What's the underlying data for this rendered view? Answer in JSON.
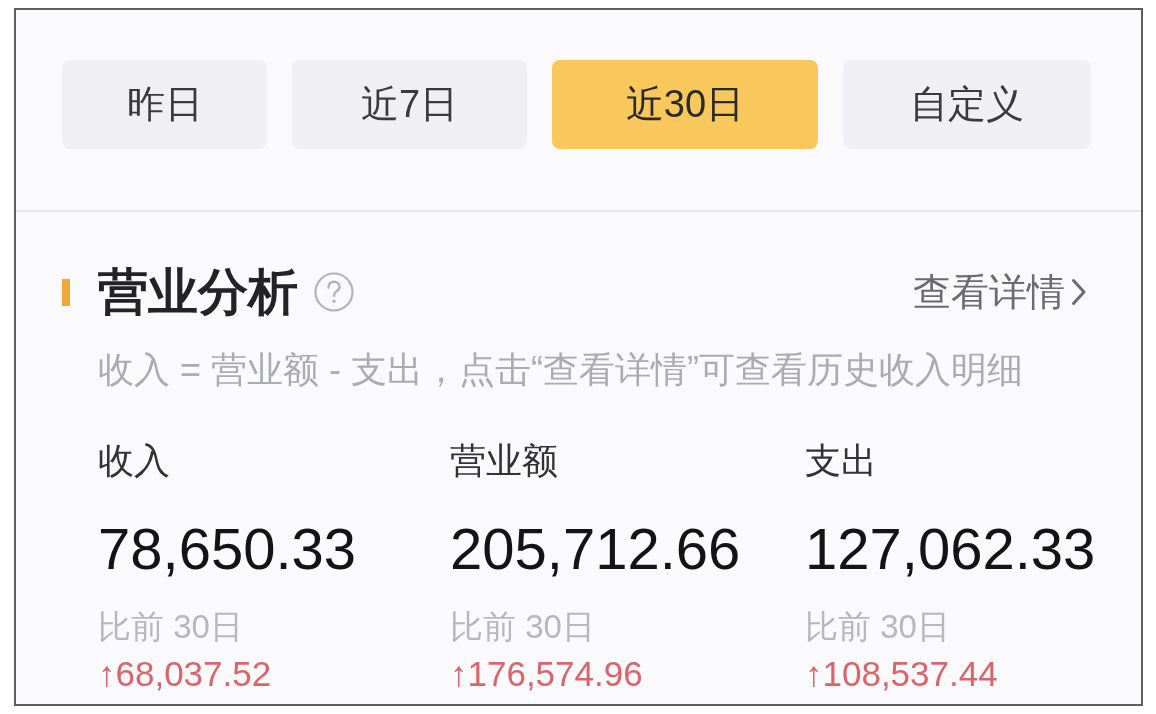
{
  "tabs": [
    {
      "label": "昨日",
      "selected": false
    },
    {
      "label": "近7日",
      "selected": false
    },
    {
      "label": "近30日",
      "selected": true
    },
    {
      "label": "自定义",
      "selected": false
    }
  ],
  "section": {
    "title": "营业分析",
    "details_link": "查看详情",
    "description": "收入 = 营业额 - 支出，点击“查看详情”可查看历史收入明细"
  },
  "metrics": [
    {
      "label": "收入",
      "value": "78,650.33",
      "comparison": "比前 30日",
      "change": "↑68,037.52"
    },
    {
      "label": "营业额",
      "value": "205,712.66",
      "comparison": "比前 30日",
      "change": "↑176,574.96"
    },
    {
      "label": "支出",
      "value": "127,062.33",
      "comparison": "比前 30日",
      "change": "↑108,537.44"
    }
  ]
}
